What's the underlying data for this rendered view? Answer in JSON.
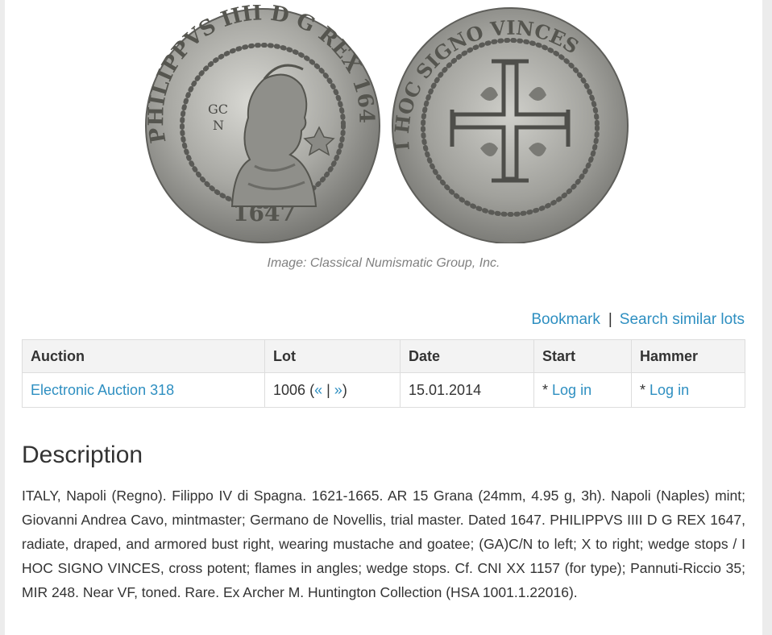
{
  "image": {
    "caption": "Image: Classical Numismatic Group, Inc.",
    "obverse_legend": "PHILIPPVS IIII D G REX 1647",
    "obverse_date": "1647",
    "obverse_field": [
      "GC",
      "N"
    ],
    "reverse_legend": "I HOC SIGNO VINCES"
  },
  "actions": {
    "bookmark": "Bookmark",
    "separator": "|",
    "search_similar": "Search similar lots"
  },
  "table": {
    "headers": {
      "auction": "Auction",
      "lot": "Lot",
      "date": "Date",
      "start": "Start",
      "hammer": "Hammer"
    },
    "row": {
      "auction": "Electronic Auction 318",
      "lot_number": "1006",
      "lot_open": "(",
      "prev": "«",
      "lot_sep": "|",
      "next": "»",
      "lot_close": ")",
      "date": "15.01.2014",
      "start_prefix": "*",
      "start_login": "Log in",
      "hammer_prefix": "*",
      "hammer_login": "Log in"
    }
  },
  "description": {
    "title": "Description",
    "text": "ITALY, Napoli (Regno). Filippo IV di Spagna. 1621-1665. AR 15 Grana (24mm, 4.95 g, 3h). Napoli (Naples) mint; Giovanni Andrea Cavo, mintmaster; Germano de Novellis, trial master. Dated 1647. PHILIPPVS IIII D G REX 1647, radiate, draped, and armored bust right, wearing mustache and goatee; (GA)C/N to left; X to right; wedge stops / I HOC SIGNO VINCES, cross potent; flames in angles; wedge stops. Cf. CNI XX 1157 (for type); Pannuti-Riccio 35; MIR 248. Near VF, toned. Rare. Ex Archer M. Huntington Collection (HSA 1001.1.22016)."
  },
  "colors": {
    "link": "#2e8fc1",
    "text": "#333333",
    "caption": "#808080",
    "coin_silver": "#a9a9a4"
  }
}
